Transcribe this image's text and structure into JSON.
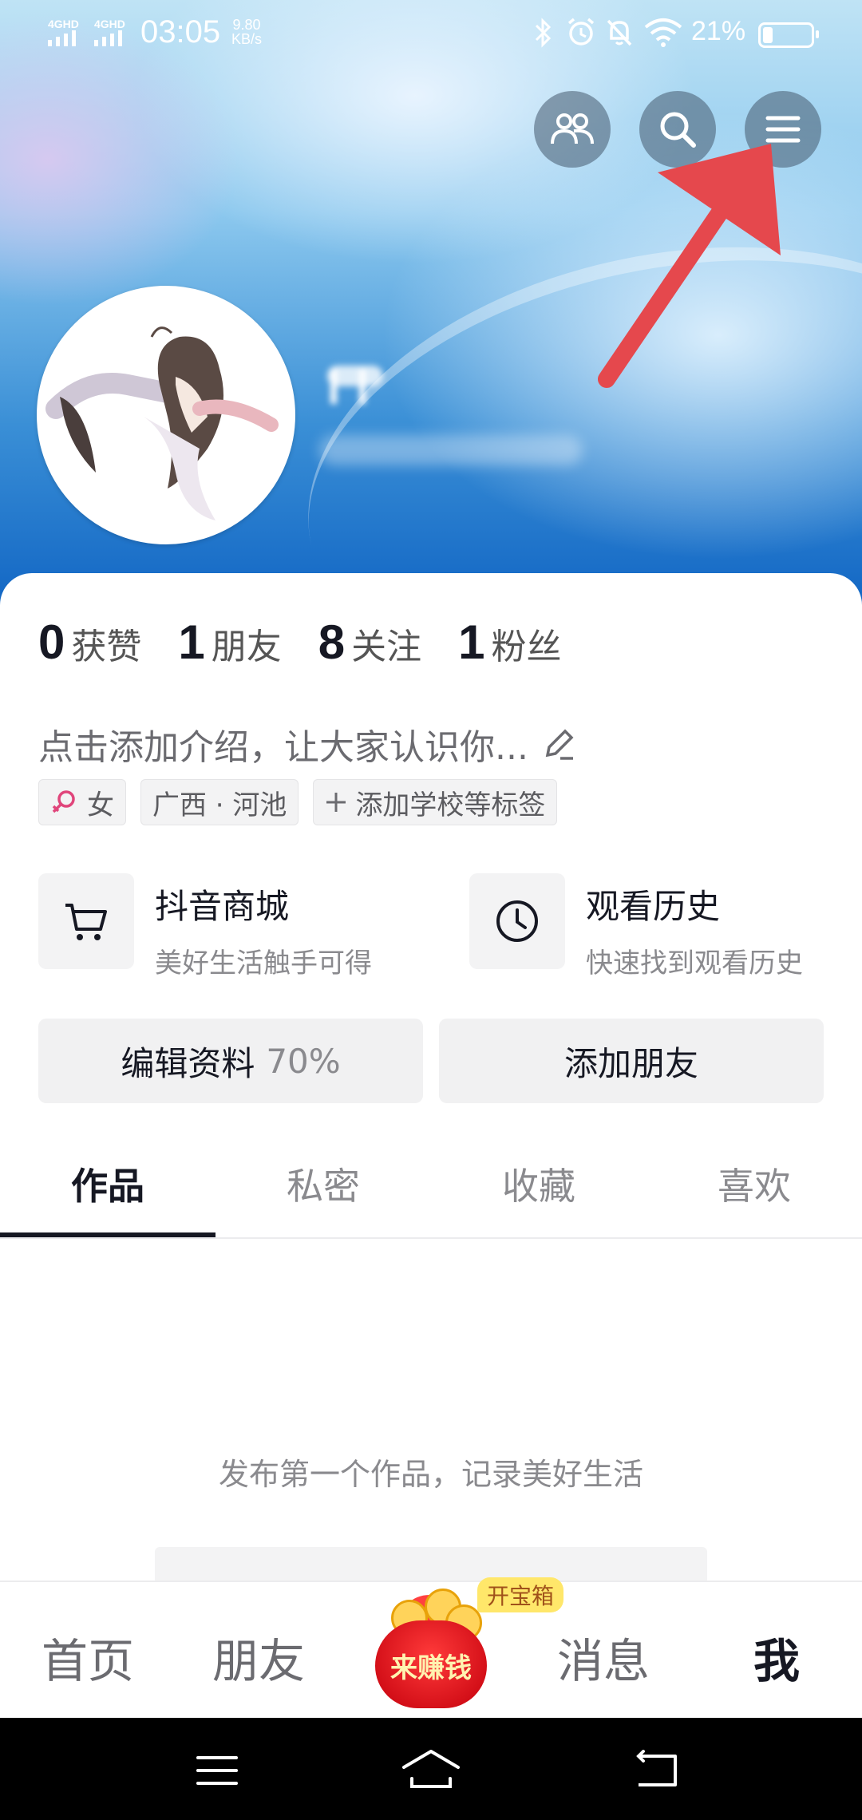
{
  "status_bar": {
    "signal_1": "4GHD",
    "signal_2": "4GHD",
    "time": "03:05",
    "speed_value": "9.80",
    "speed_unit": "KB/s",
    "battery_pct": "21%",
    "battery_level": 0.21
  },
  "header": {
    "friends_icon": "friends-icon",
    "search_icon": "search-icon",
    "menu_icon": "menu-icon"
  },
  "profile": {
    "stats": [
      {
        "num": "0",
        "label": "获赞"
      },
      {
        "num": "1",
        "label": "朋友"
      },
      {
        "num": "8",
        "label": "关注"
      },
      {
        "num": "1",
        "label": "粉丝"
      }
    ],
    "bio_placeholder": "点击添加介绍，让大家认识你...",
    "tags": {
      "gender": "女",
      "location": "广西 · 河池",
      "add_tag": "添加学校等标签"
    }
  },
  "shortcuts": {
    "mall": {
      "title": "抖音商城",
      "subtitle": "美好生活触手可得"
    },
    "history": {
      "title": "观看历史",
      "subtitle": "快速找到观看历史"
    }
  },
  "actions": {
    "edit_label": "编辑资料",
    "edit_pct": "70%",
    "add_friends": "添加朋友"
  },
  "tabs": [
    "作品",
    "私密",
    "收藏",
    "喜欢"
  ],
  "empty_state": "发布第一个作品，记录美好生活",
  "bottom_nav": {
    "home": "首页",
    "friends": "朋友",
    "earn": "来赚钱",
    "earn_badge": "开宝箱",
    "messages": "消息",
    "me": "我"
  },
  "colors": {
    "annotation_arrow": "#e5484d",
    "gender_icon": "#e0457b",
    "earn_red": "#e0101c"
  }
}
